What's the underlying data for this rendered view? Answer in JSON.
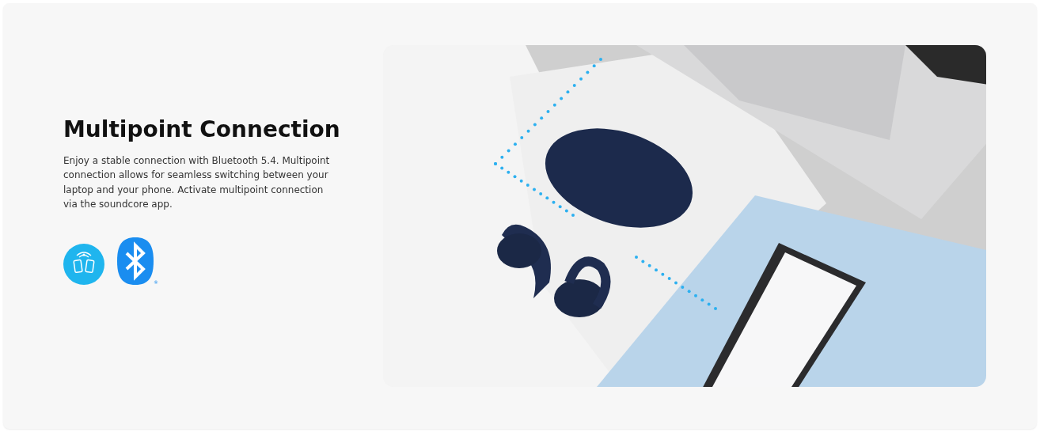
{
  "feature": {
    "title": "Multipoint Connection",
    "description": "Enjoy a stable connection with Bluetooth 5.4. Multipoint connection allows for seamless switching between your laptop and your phone. Activate multipoint connection via the soundcore app.",
    "registered_mark": "®"
  }
}
